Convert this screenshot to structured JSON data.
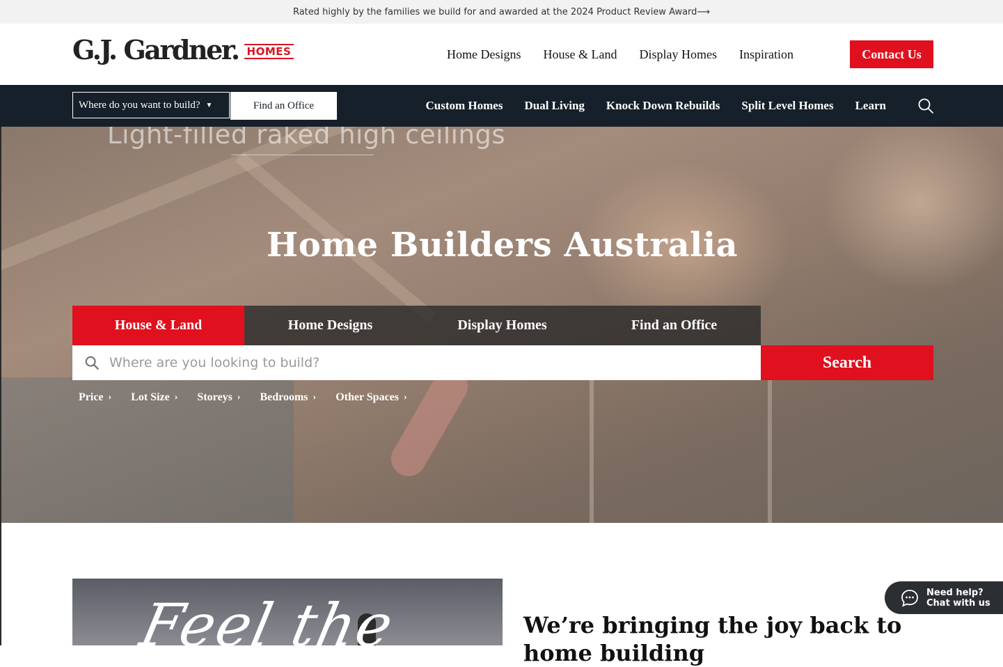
{
  "announcement": "Rated highly by the families we build for and awarded at the 2024 Product Review Award⟶",
  "logo": {
    "name": "G.J. Gardner.",
    "badge": "HOMES"
  },
  "main_nav": [
    "Home Designs",
    "House & Land",
    "Display Homes",
    "Inspiration"
  ],
  "contact_button": "Contact Us",
  "subbar": {
    "where_select": "Where do you want to build?",
    "find_office": "Find an Office",
    "links": [
      "Custom Homes",
      "Dual Living",
      "Knock Down Rebuilds",
      "Split Level Homes",
      "Learn"
    ]
  },
  "hero": {
    "tagline": "Light-filled raked high ceilings",
    "title": "Home Builders Australia",
    "tabs": [
      {
        "label": "House & Land",
        "active": true
      },
      {
        "label": "Home Designs",
        "active": false
      },
      {
        "label": "Display Homes",
        "active": false
      },
      {
        "label": "Find an Office",
        "active": false
      }
    ],
    "search_placeholder": "Where are you looking to build?",
    "search_button": "Search",
    "filters": [
      "Price",
      "Lot Size",
      "Storeys",
      "Bedrooms",
      "Other Spaces"
    ]
  },
  "feature": {
    "image_script": "Feel the",
    "heading": "We’re bringing the joy back to home building"
  },
  "chat": {
    "line1": "Need help?",
    "line2": "Chat with us"
  },
  "colors": {
    "accent": "#e0101e",
    "dark_bar": "#16202a"
  },
  "icons": [
    "search-icon",
    "chevron-down-icon",
    "chevron-right-icon",
    "chat-bubble-icon",
    "magnifier-icon"
  ]
}
